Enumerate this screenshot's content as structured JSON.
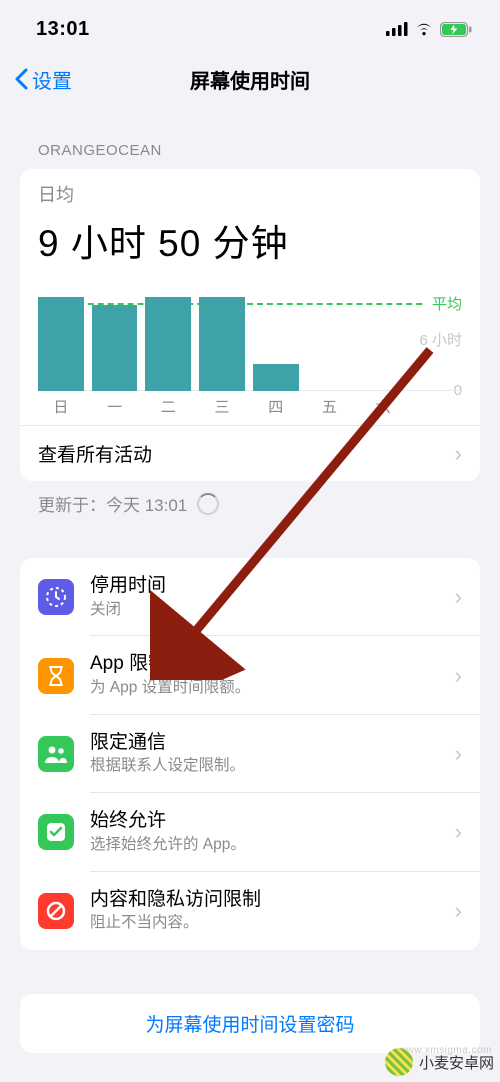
{
  "status": {
    "time": "13:01"
  },
  "nav": {
    "back": "设置",
    "title": "屏幕使用时间"
  },
  "summary": {
    "header": "ORANGEOCEAN",
    "daily_avg_label": "日均",
    "daily_avg_value": "9 小时 50 分钟"
  },
  "chart_data": {
    "type": "bar",
    "categories": [
      "日",
      "一",
      "二",
      "三",
      "四",
      "五",
      "六"
    ],
    "values": [
      12,
      11,
      12,
      12,
      3.5,
      0,
      0
    ],
    "ylim": [
      0,
      14
    ],
    "avg_value": 9.83,
    "avg_label": "平均",
    "tick_label_mid": "6 小时",
    "tick_label_zero": "0",
    "ylabel": "",
    "xlabel": "",
    "title": ""
  },
  "view_all": {
    "label": "查看所有活动"
  },
  "updated": {
    "text": "更新于：今天 13:01"
  },
  "options": [
    {
      "title": "停用时间",
      "subtitle": "关闭",
      "color": "#5e5ce6",
      "icon": "downtime-icon"
    },
    {
      "title": "App 限额",
      "subtitle": "为 App 设置时间限额。",
      "color": "#ff9500",
      "icon": "hourglass-icon"
    },
    {
      "title": "限定通信",
      "subtitle": "根据联系人设定限制。",
      "color": "#34c759",
      "icon": "people-icon"
    },
    {
      "title": "始终允许",
      "subtitle": "选择始终允许的 App。",
      "color": "#34c759",
      "icon": "check-icon"
    },
    {
      "title": "内容和隐私访问限制",
      "subtitle": "阻止不当内容。",
      "color": "#ff3b30",
      "icon": "nosign-icon"
    }
  ],
  "passcode": {
    "label": "为屏幕使用时间设置密码"
  },
  "watermark": {
    "text": "小麦安卓网",
    "url": "www.xmsigma.com"
  }
}
